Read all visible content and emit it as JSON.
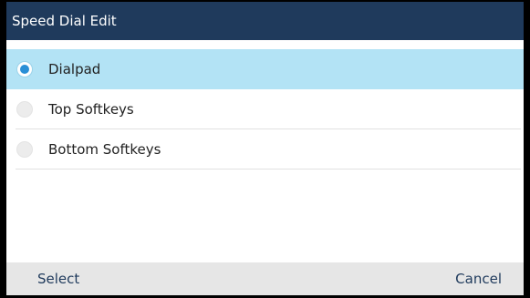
{
  "title": "Speed Dial Edit",
  "options": [
    {
      "label": "Dialpad",
      "selected": true
    },
    {
      "label": "Top Softkeys",
      "selected": false
    },
    {
      "label": "Bottom Softkeys",
      "selected": false
    }
  ],
  "softkeys": {
    "left": "Select",
    "right": "Cancel"
  },
  "colors": {
    "titlebar": "#1f3a5c",
    "selection": "#b3e3f5",
    "radio_dot": "#2a8fd6",
    "softkey_bar": "#e6e6e6"
  },
  "icons": {
    "selected": "radio-selected-icon",
    "unselected": "radio-unselected-icon"
  }
}
